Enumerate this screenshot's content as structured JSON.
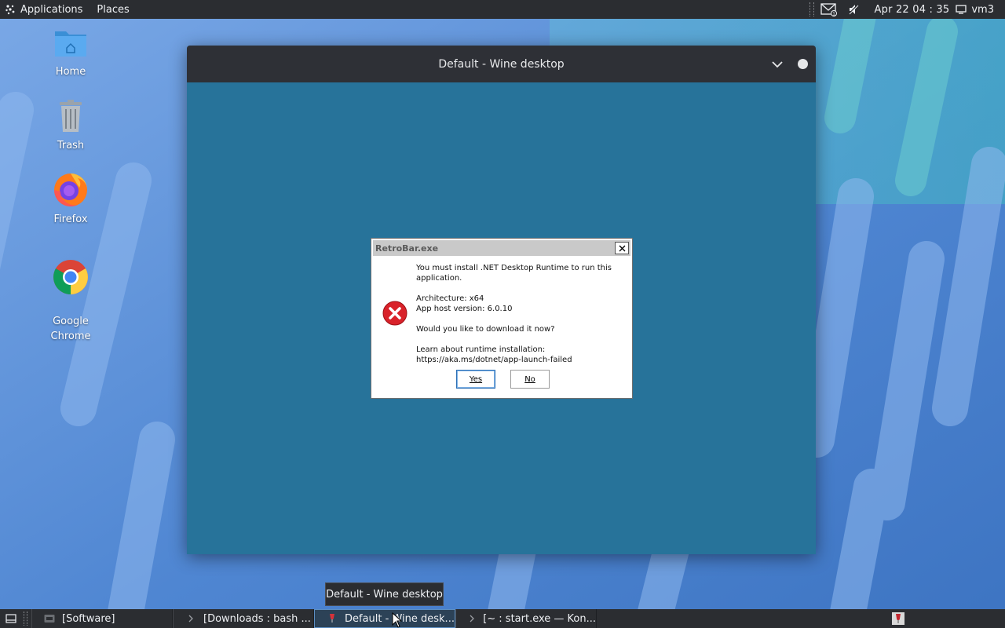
{
  "top_panel": {
    "applications_label": "Applications",
    "places_label": "Places",
    "clock": "Apr 22  04 : 35",
    "user": "vm3"
  },
  "desktop_icons": [
    {
      "label": "Home"
    },
    {
      "label": "Trash"
    },
    {
      "label": "Firefox"
    },
    {
      "label": "Google\nChrome"
    }
  ],
  "wine_window": {
    "title": "Default - Wine desktop",
    "background_color": "#27739a"
  },
  "dialog": {
    "title": "RetroBar.exe",
    "message_lines": [
      "You must install .NET Desktop Runtime to run this application.",
      "Architecture: x64",
      "App host version: 6.0.10",
      "Would you like to download it now?",
      "Learn about runtime installation:",
      "https://aka.ms/dotnet/app-launch-failed"
    ],
    "yes_label": "Yes",
    "no_label": "No"
  },
  "tooltip": "Default - Wine desktop",
  "taskbar": {
    "tasks": [
      {
        "label": "[Software]",
        "active": false
      },
      {
        "label": "[Downloads : bash ...",
        "active": false
      },
      {
        "label": "Default - Wine desk...",
        "active": true
      },
      {
        "label": "[~ : start.exe — Kon...",
        "active": false
      }
    ]
  },
  "colors": {
    "panel": "#2b2d31",
    "accent": "#5c8fc4",
    "wallpaper": "#4f86d2"
  }
}
